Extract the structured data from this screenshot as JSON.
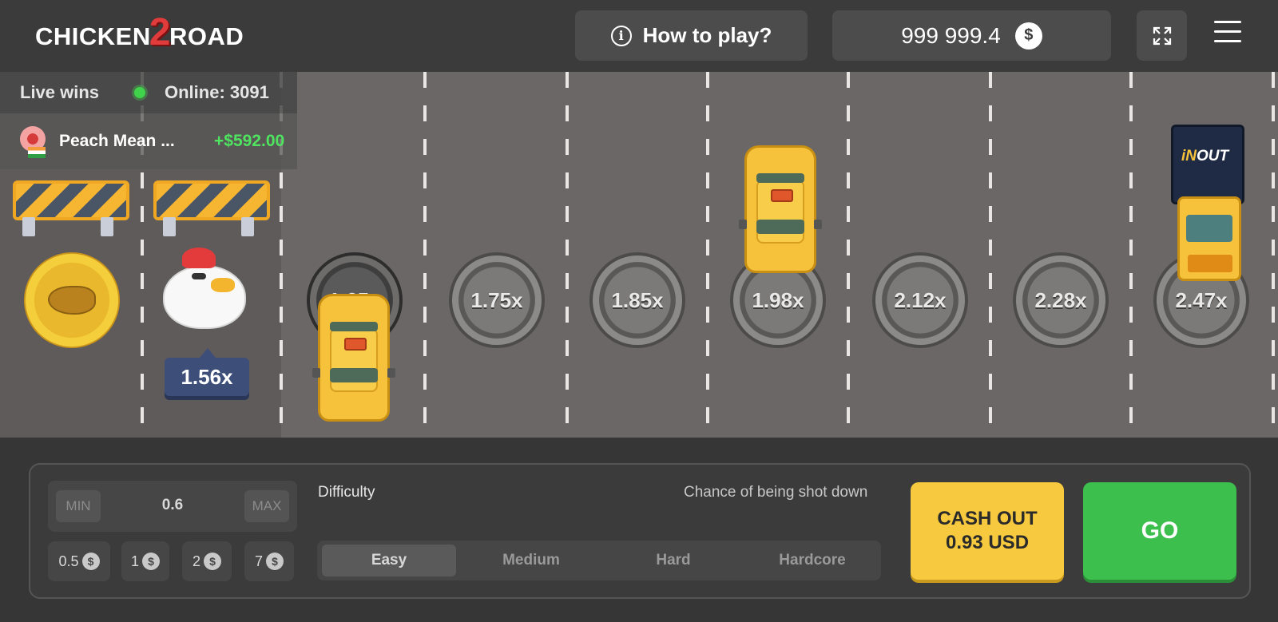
{
  "header": {
    "logo_text_left": "CHICKEN",
    "logo_text_two": "2",
    "logo_text_right": "ROAD",
    "how_to_play_label": "How to play?",
    "how_to_play_icon": "info-icon",
    "balance": "999 999.4",
    "currency_icon": "dollar-coin-icon",
    "currency_symbol": "$",
    "fullscreen_icon": "expand-icon",
    "menu_icon": "hamburger-menu-icon"
  },
  "live": {
    "label": "Live wins",
    "online": "Online: 3091",
    "latest_win": {
      "name": "Peach Mean ...",
      "amount": "+$592.00"
    }
  },
  "road": {
    "current_multiplier": "1.56x",
    "current_lane_multiplier": "1.65x",
    "lanes": [
      "1.75x",
      "1.85x",
      "1.98x",
      "2.12x",
      "2.28x",
      "2.47x"
    ],
    "truck_brand_prefix": "iN",
    "truck_brand_suffix": "OUT"
  },
  "controls": {
    "min_label": "MIN",
    "max_label": "MAX",
    "bet_value": "0.6",
    "chips": [
      "0.5",
      "1",
      "2",
      "7"
    ],
    "difficulty_label": "Difficulty",
    "chance_label": "Chance of being shot down",
    "difficulties": [
      "Easy",
      "Medium",
      "Hard",
      "Hardcore"
    ],
    "selected_difficulty": "Easy",
    "cashout_line1": "CASH OUT",
    "cashout_line2": "0.93 USD",
    "go_label": "GO"
  },
  "colors": {
    "accent_yellow": "#f6c93f",
    "go_green": "#3dbf4e",
    "win_green": "#4fe360",
    "multiplier_tag": "#3d4e79"
  }
}
